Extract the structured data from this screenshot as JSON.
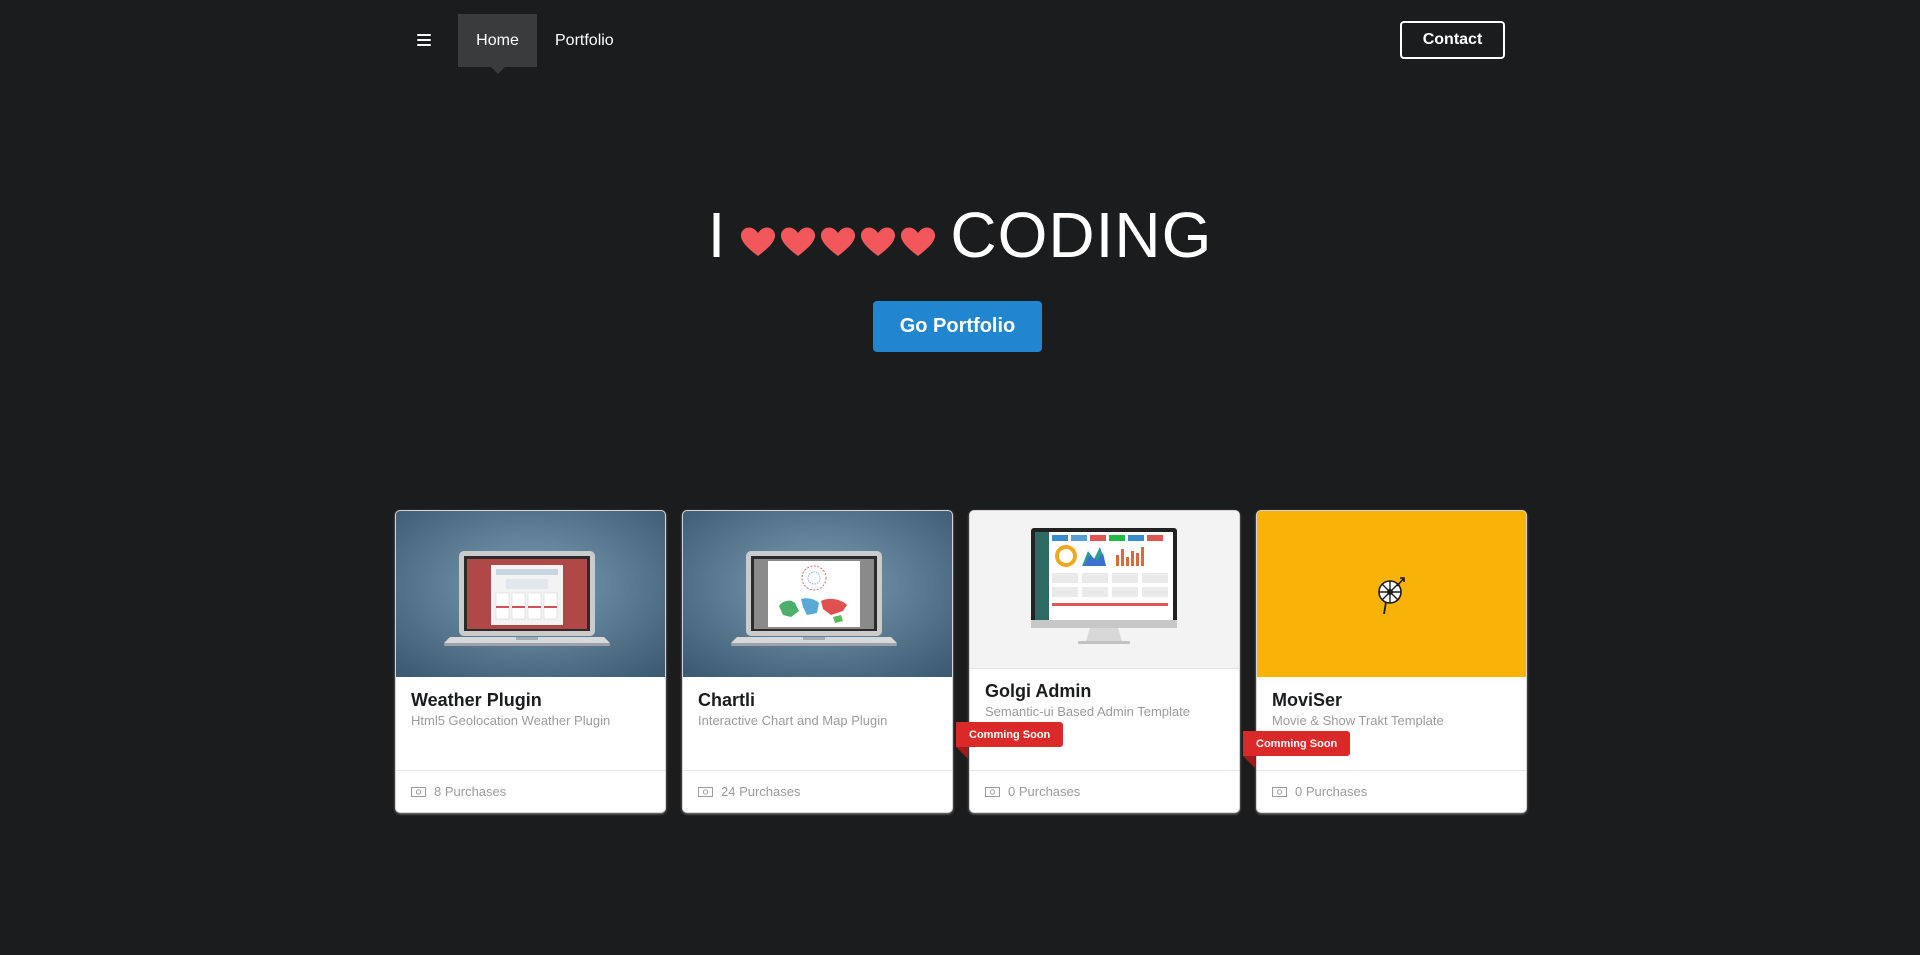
{
  "nav": {
    "menu_icon": "hamburger-icon",
    "items": [
      {
        "label": "Home",
        "active": true
      },
      {
        "label": "Portfolio",
        "active": false
      }
    ],
    "contact_label": "Contact"
  },
  "hero": {
    "title_left": "I",
    "hearts_count": 5,
    "heart_icon": "heart-icon",
    "heart_color": "#f2575b",
    "title_right": "CODING",
    "button_label": "Go Portfolio",
    "button_color": "#2185d0"
  },
  "cards": [
    {
      "title": "Weather Plugin",
      "subtitle": "Html5 Geolocation Weather Plugin",
      "purchases": "8 Purchases",
      "ribbon": ""
    },
    {
      "title": "Chartli",
      "subtitle": "Interactive Chart and Map Plugin",
      "purchases": "24 Purchases",
      "ribbon": ""
    },
    {
      "title": "Golgi Admin",
      "subtitle": "Semantic-ui Based Admin Template",
      "purchases": "0 Purchases",
      "ribbon": "Comming Soon"
    },
    {
      "title": "MoviSer",
      "subtitle": "Movie & Show Trakt Template",
      "purchases": "0 Purchases",
      "ribbon": "Comming Soon"
    }
  ],
  "colors": {
    "background": "#1b1c1d",
    "ribbon": "#db2828",
    "moviser_bg": "#f9b208"
  }
}
